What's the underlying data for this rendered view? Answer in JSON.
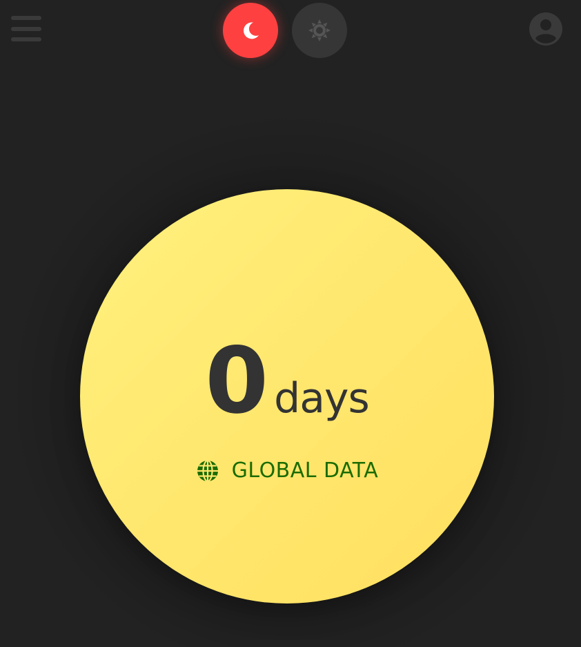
{
  "header": {
    "menu_icon": "hamburger-menu-icon",
    "night_mode_icon": "moon-icon",
    "day_mode_icon": "sun-icon",
    "account_icon": "user-account-icon",
    "active_mode": "night"
  },
  "counter": {
    "value": "0",
    "unit": "days",
    "scope_icon": "globe-icon",
    "scope_label": "GLOBAL DATA"
  },
  "colors": {
    "background": "#222222",
    "night_active": "#ff4040",
    "day_inactive": "#363636",
    "circle_fill": "#ffe76e",
    "count_text": "#333333",
    "scope_text": "#1a6b00"
  }
}
